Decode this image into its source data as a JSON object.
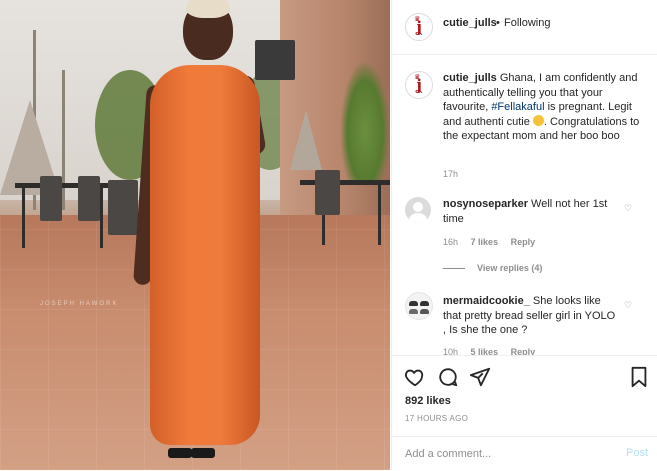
{
  "post": {
    "photo_watermark": "JOSEPH HAWORK"
  },
  "header": {
    "username": "cutie_julls",
    "separator": "•",
    "follow_status": "Following",
    "avatar_icon": "cutie-julls-logo-icon"
  },
  "caption": {
    "username": "cutie_julls",
    "text_before_tag": "Ghana, I am confidently and authentically telling you that your favourite, ",
    "hashtag": "#Fellakaful",
    "text_after_tag": " is pregnant. Legit and authenti cutie ",
    "emoji_icon": "face-with-hand-over-mouth-emoji",
    "text_end": ". Congratulations to the expectant mom and her boo boo",
    "time": "17h"
  },
  "comments": [
    {
      "username": "nosynoseparker",
      "text": "Well not her 1st time",
      "time": "16h",
      "likes": "7 likes",
      "reply_label": "Reply",
      "view_replies": "View replies (4)",
      "avatar_icon": "default-avatar-icon"
    },
    {
      "username": "mermaidcookie_",
      "text": "She looks like that pretty bread seller girl in YOLO , Is she the one ?",
      "time": "10h",
      "likes": "5 likes",
      "reply_label": "Reply",
      "avatar_icon": "shoes-avatar-icon"
    }
  ],
  "actions": {
    "like_icon": "heart-icon",
    "comment_icon": "comment-icon",
    "share_icon": "share-icon",
    "save_icon": "bookmark-icon",
    "likes_count": "892 likes",
    "posted_ago": "17 HOURS AGO"
  },
  "add_comment": {
    "placeholder": "Add a comment...",
    "post_label": "Post"
  },
  "colors": {
    "link": "#00376b",
    "muted": "#8e8e8e",
    "post_disabled": "#b2dffc",
    "brand_red": "#b0141c"
  }
}
